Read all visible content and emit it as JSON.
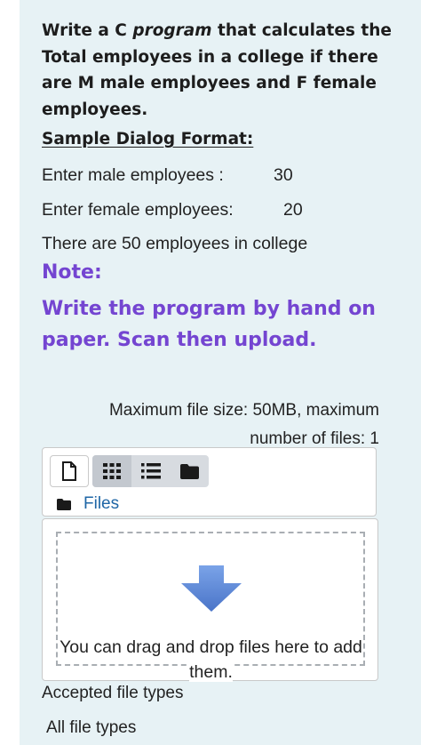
{
  "question": {
    "text_before": "Write a C ",
    "text_em": "program",
    "text_after": " that calculates the Total employees in a college if there are M male employees and F female employees.",
    "sample_heading": "Sample Dialog Format:",
    "lines": [
      {
        "label": "Enter male employees  :",
        "value": "30"
      },
      {
        "label": "Enter female employees:",
        "value": "20"
      }
    ],
    "result_line": "There are 50 employees in college",
    "note_heading": "Note:",
    "note_text": "Write the program by hand on paper. Scan then upload."
  },
  "filepicker": {
    "info_line1": "Maximum file size: 50MB, maximum",
    "info_line2": "number of files: 1",
    "path_label": "Files",
    "drop_text": "You can drag and drop files here to add them.",
    "accepted_label": "Accepted file types",
    "accepted_value": "All file types"
  },
  "icons": {
    "add_file": "file-icon",
    "view_icons": "grid-icon",
    "view_list": "list-icon",
    "view_tree": "folder-icon",
    "path_folder": "folder-icon",
    "drop_arrow": "arrow-down-icon"
  },
  "colors": {
    "panel_bg": "#e7f2f5",
    "note": "#7445d1",
    "link": "#1f66a6",
    "arrow": "#5b86d6"
  }
}
